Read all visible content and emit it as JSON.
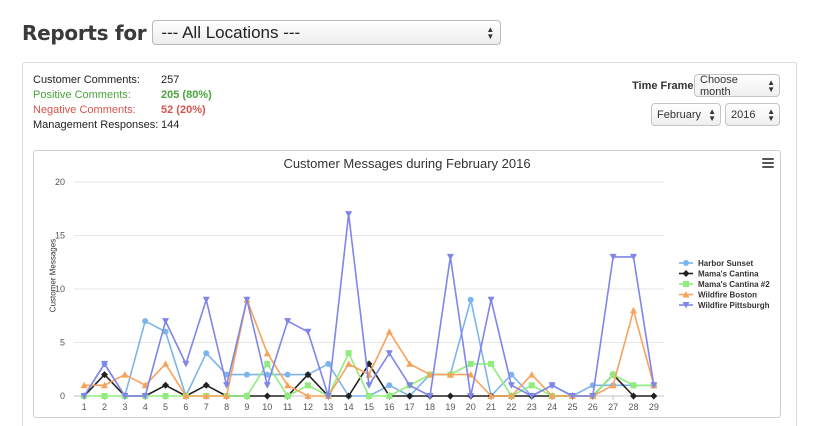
{
  "header": {
    "title": "Reports for",
    "location_select": "--- All Locations ---"
  },
  "stats": [
    {
      "label": "Customer Comments:",
      "value": "257",
      "kind": "normal"
    },
    {
      "label": "Positive Comments:",
      "value": "205 (80%)",
      "kind": "positive"
    },
    {
      "label": "Negative Comments:",
      "value": "52 (20%)",
      "kind": "negative"
    },
    {
      "label": "Management Responses:",
      "value": "144",
      "kind": "normal"
    }
  ],
  "timeframe": {
    "label": "Time Frame",
    "select": "Choose month",
    "month": "February",
    "year": "2016"
  },
  "icons": {
    "menu": "hamburger-menu-icon",
    "stepper": "up-down-arrow-icon"
  },
  "chart_data": {
    "type": "line",
    "title": "Customer Messages during February 2016",
    "xlabel": "",
    "ylabel": "Customer Messages",
    "ylim": [
      0,
      20
    ],
    "yticks": [
      0,
      5,
      10,
      15,
      20
    ],
    "grid": true,
    "legend_position": "right",
    "x": [
      1,
      2,
      3,
      4,
      5,
      6,
      7,
      8,
      9,
      10,
      11,
      12,
      13,
      14,
      15,
      16,
      17,
      18,
      19,
      20,
      21,
      22,
      23,
      24,
      25,
      26,
      27,
      28,
      29
    ],
    "series": [
      {
        "name": "Harbor Sunset",
        "color": "#7cb5ec",
        "marker": "circle",
        "values": [
          0,
          3,
          0,
          7,
          6,
          0,
          4,
          2,
          2,
          2,
          2,
          2,
          3,
          0,
          0,
          1,
          0,
          2,
          2,
          9,
          0,
          2,
          0,
          1,
          0,
          1,
          1,
          1,
          1
        ]
      },
      {
        "name": "Mama's Cantina",
        "color": "#222222",
        "marker": "diamond",
        "values": [
          0,
          2,
          0,
          0,
          1,
          0,
          1,
          0,
          0,
          0,
          0,
          2,
          0,
          0,
          3,
          0,
          0,
          0,
          0,
          0,
          0,
          0,
          0,
          0,
          0,
          0,
          2,
          0,
          0
        ]
      },
      {
        "name": "Mama's Cantina #2",
        "color": "#90ed7d",
        "marker": "square",
        "values": [
          0,
          0,
          0,
          0,
          0,
          0,
          0,
          0,
          0,
          3,
          0,
          1,
          0,
          4,
          0,
          0,
          1,
          2,
          2,
          3,
          3,
          0,
          1,
          0,
          0,
          0,
          2,
          1,
          1
        ]
      },
      {
        "name": "Wildfire Boston",
        "color": "#f7a35c",
        "marker": "triangle",
        "values": [
          1,
          1,
          2,
          1,
          3,
          0,
          0,
          0,
          9,
          4,
          1,
          0,
          0,
          3,
          2,
          6,
          3,
          2,
          2,
          2,
          0,
          0,
          2,
          0,
          0,
          0,
          1,
          8,
          1
        ]
      },
      {
        "name": "Wildfire Pittsburgh",
        "color": "#8085e9",
        "marker": "triangle-down",
        "values": [
          0,
          3,
          0,
          0,
          7,
          3,
          9,
          1,
          9,
          1,
          7,
          6,
          0,
          17,
          1,
          4,
          1,
          0,
          13,
          0,
          9,
          1,
          0,
          1,
          0,
          0,
          13,
          13,
          1
        ]
      }
    ]
  }
}
